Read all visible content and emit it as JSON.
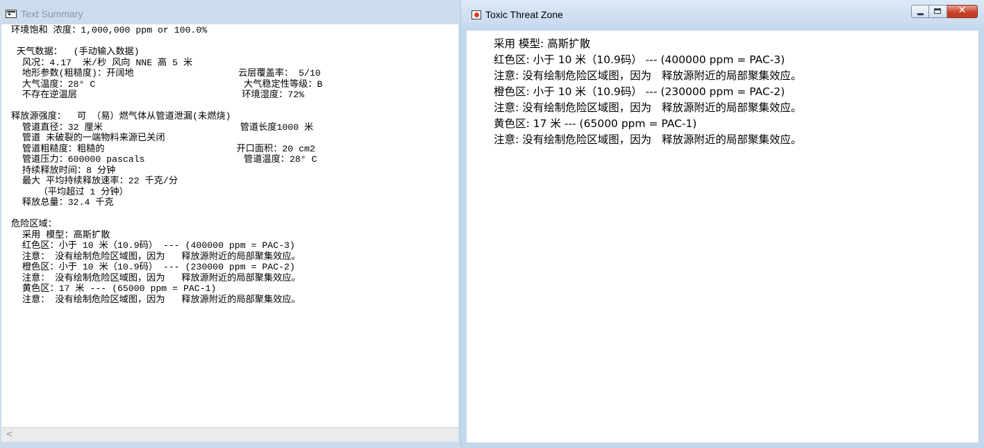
{
  "left_window": {
    "title": "Text Summary",
    "lines": [
      "环境饱和 浓度：1,000,000 ppm or 100.0%",
      "",
      " 天气数据：  (手动输入数据)",
      "  风况：4.17  米/秒 风向 NNE 高 5 米",
      "  地形参数(粗糙度)：开阔地                   云层覆盖率： 5/10",
      "  大气温度：28° C                           大气稳定性等级：B",
      "  不存在逆温层                              环境湿度：72%",
      "",
      "释放源强度：  可 （易）燃气体从管道泄漏(未燃烧)",
      "  管道直径：32 厘米                         管道长度1000 米",
      "  管道 未破裂的一端物料来源已关闭",
      "  管道粗糙度：粗糙的                        开口面积：20 cm2",
      "  管道压力：600000 pascals                  管道温度：28° C",
      "  持续释放时间：8 分钟",
      "  最大 平均持续释放速率：22 千克/分",
      "     （平均超过 1 分钟）",
      "  释放总量：32.4 千克",
      "",
      "危险区域：",
      "  采用 模型：高斯扩散",
      "  红色区：小于 10 米（10.9码） --- (400000 ppm = PAC-3)",
      "  注意： 没有绘制危险区域图，因为   释放源附近的局部聚集效应。",
      "  橙色区：小于 10 米（10.9码） --- (230000 ppm = PAC-2)",
      "  注意： 没有绘制危险区域图，因为   释放源附近的局部聚集效应。",
      "  黄色区：17 米 --- (65000 ppm = PAC-1)",
      "  注意： 没有绘制危险区域图，因为   释放源附近的局部聚集效应。"
    ],
    "scroll_left_glyph": "<"
  },
  "right_window": {
    "title": "Toxic Threat Zone",
    "close_glyph": "✕",
    "lines": [
      "采用 模型: 高斯扩散",
      "红色区: 小于 10 米（10.9码） --- (400000 ppm = PAC-3)",
      "注意: 没有绘制危险区域图，因为   释放源附近的局部聚集效应。",
      "橙色区: 小于 10 米（10.9码） --- (230000 ppm = PAC-2)",
      "注意: 没有绘制危险区域图，因为   释放源附近的局部聚集效应。",
      "黄色区: 17 米 --- (65000 ppm = PAC-1)",
      "注意: 没有绘制危险区域图，因为   释放源附近的局部聚集效应。"
    ]
  },
  "icons": {
    "left_app": "text-summary-app-icon",
    "right_app": "threat-zone-app-icon",
    "minimize": "minimize-icon",
    "maximize": "maximize-icon",
    "close": "close-icon"
  },
  "colors": {
    "inactive_title_text": "#8597ab",
    "active_title_text": "#000000",
    "close_button_red": "#c7442c",
    "desktop_frame": "#ccdcee"
  }
}
